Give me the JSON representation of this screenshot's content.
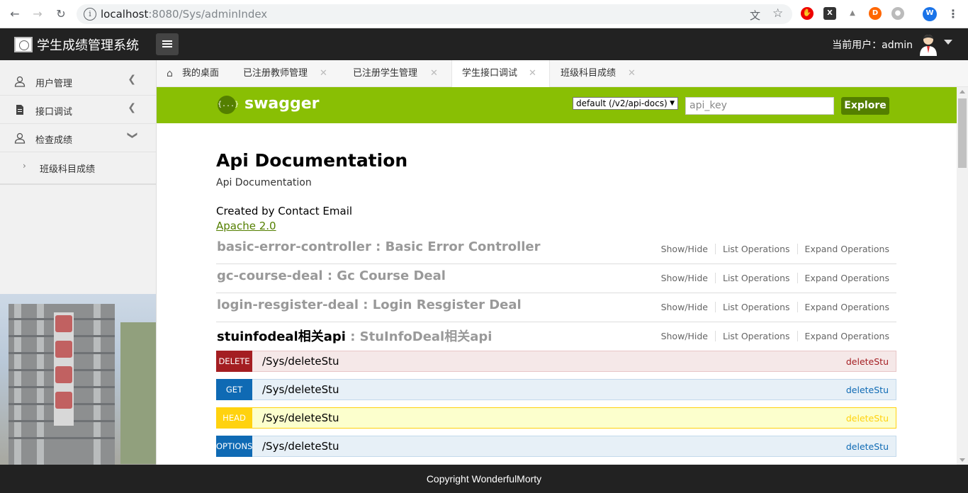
{
  "browser": {
    "url_host": "localhost",
    "url_rest": ":8080/Sys/adminIndex"
  },
  "app": {
    "title": "学生成绩管理系统",
    "current_user_label": "当前用户：admin"
  },
  "sidebar": {
    "items": [
      {
        "label": "用户管理",
        "icon": "user-icon"
      },
      {
        "label": "接口调试",
        "icon": "document-icon"
      },
      {
        "label": "检查成绩",
        "icon": "user-icon"
      }
    ],
    "sub_items": [
      {
        "label": "班级科目成绩"
      }
    ]
  },
  "tabs": [
    {
      "label": "我的桌面",
      "icon": "home-icon"
    },
    {
      "label": "已注册教师管理"
    },
    {
      "label": "已注册学生管理"
    },
    {
      "label": "学生接口调试",
      "active": true
    },
    {
      "label": "班级科目成绩"
    }
  ],
  "swagger": {
    "brand": "swagger",
    "logo_glyph": "{...}",
    "spec_select": "default (/v2/api-docs)",
    "api_key_placeholder": "api_key",
    "explore_label": "Explore",
    "doc_title": "Api Documentation",
    "doc_description": "Api Documentation",
    "created_by": "Created by Contact Email",
    "license": "Apache 2.0",
    "ops_labels": {
      "show_hide": "Show/Hide",
      "list": "List Operations",
      "expand": "Expand Operations"
    },
    "resources": [
      {
        "key": "basic-error-controller",
        "desc": "Basic Error Controller"
      },
      {
        "key": "gc-course-deal",
        "desc": "Gc Course Deal"
      },
      {
        "key": "login-resgister-deal",
        "desc": "Login Resgister Deal"
      },
      {
        "key": "stuinfodeal相关api",
        "desc": "StuInfoDeal相关api"
      }
    ],
    "operations": [
      {
        "method": "DELETE",
        "path": "/Sys/deleteStu",
        "nickname": "deleteStu",
        "color": "#a41e22",
        "bg": "#f5e8e8",
        "border": "#e8c6c7",
        "name_color": "#a41e22"
      },
      {
        "method": "GET",
        "path": "/Sys/deleteStu",
        "nickname": "deleteStu",
        "color": "#0f6ab4",
        "bg": "#e7f0f7",
        "border": "#c3d9ec",
        "name_color": "#0f6ab4"
      },
      {
        "method": "HEAD",
        "path": "/Sys/deleteStu",
        "nickname": "deleteStu",
        "color": "#ffd20f",
        "bg": "#fcffcd",
        "border": "#ffd20f",
        "name_color": "#ffd20f"
      },
      {
        "method": "OPTIONS",
        "path": "/Sys/deleteStu",
        "nickname": "deleteStu",
        "color": "#0f6ab4",
        "bg": "#e7f0f7",
        "border": "#c3d9ec",
        "name_color": "#0f6ab4"
      }
    ]
  },
  "footer": {
    "text": "Copyright WonderfulMorty"
  }
}
